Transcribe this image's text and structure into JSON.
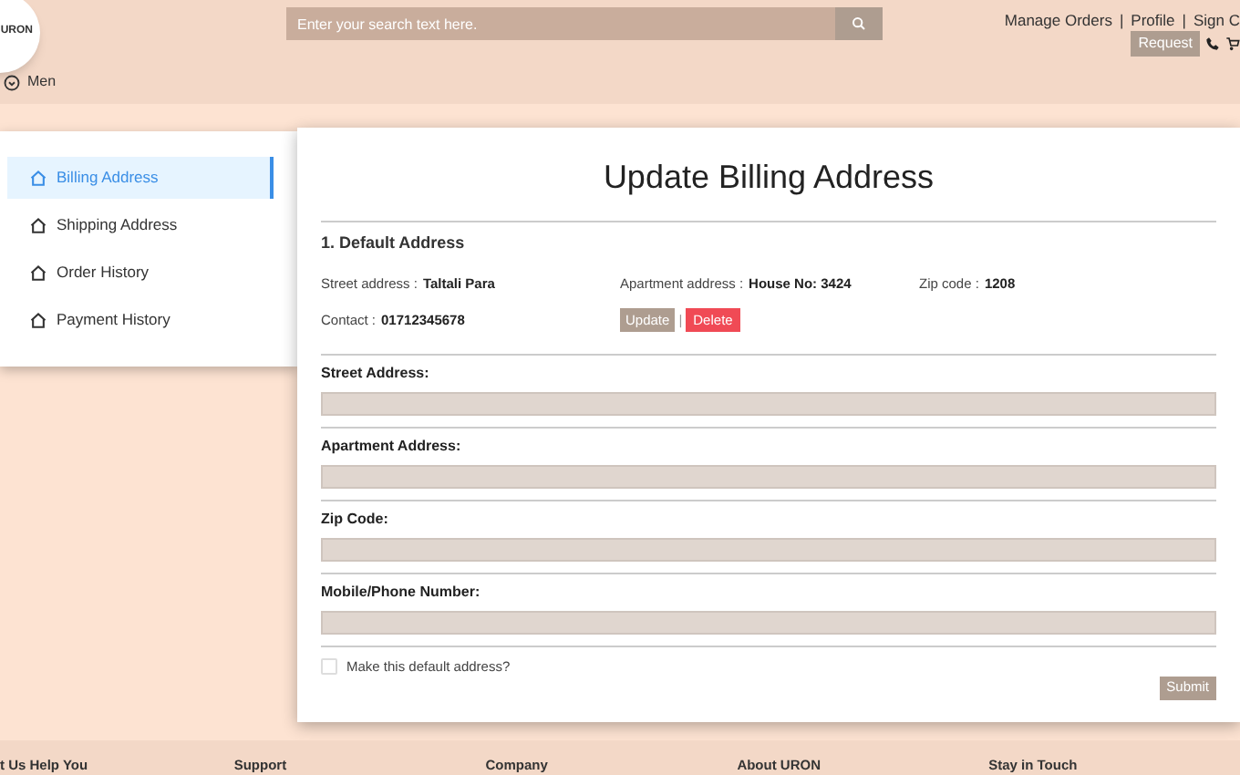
{
  "header": {
    "logo": "URON",
    "category": "Men",
    "search": {
      "placeholder": "Enter your search text here."
    },
    "links": [
      "Manage Orders",
      "|",
      "Profile",
      "|",
      "Sign C"
    ],
    "request_button": "Request"
  },
  "sidebar": {
    "items": [
      {
        "label": "Billing Address",
        "selected": true
      },
      {
        "label": "Shipping Address",
        "selected": false
      },
      {
        "label": "Order History",
        "selected": false
      },
      {
        "label": "Payment History",
        "selected": false
      }
    ]
  },
  "main": {
    "title": "Update Billing Address",
    "address_heading": "1. Default Address",
    "details": [
      {
        "label": "Street address :",
        "value": "Taltali Para"
      },
      {
        "label": "Apartment address :",
        "value": "House No: 3424"
      },
      {
        "label": "Zip code :",
        "value": "1208"
      },
      {
        "label": "Contact :",
        "value": "01712345678"
      }
    ],
    "update_button": "Update",
    "separator": "|",
    "delete_button": "Delete",
    "fields": [
      {
        "label": "Street Address:"
      },
      {
        "label": "Apartment Address:"
      },
      {
        "label": "Zip Code:"
      },
      {
        "label": "Mobile/Phone Number:"
      }
    ],
    "default_checkbox": {
      "label": "Make this default address?",
      "checked": false
    },
    "submit_button": "Submit"
  },
  "footer": {
    "headings": [
      "t Us Help You",
      "Support",
      "Company",
      "About URON",
      "Stay in Touch"
    ]
  }
}
